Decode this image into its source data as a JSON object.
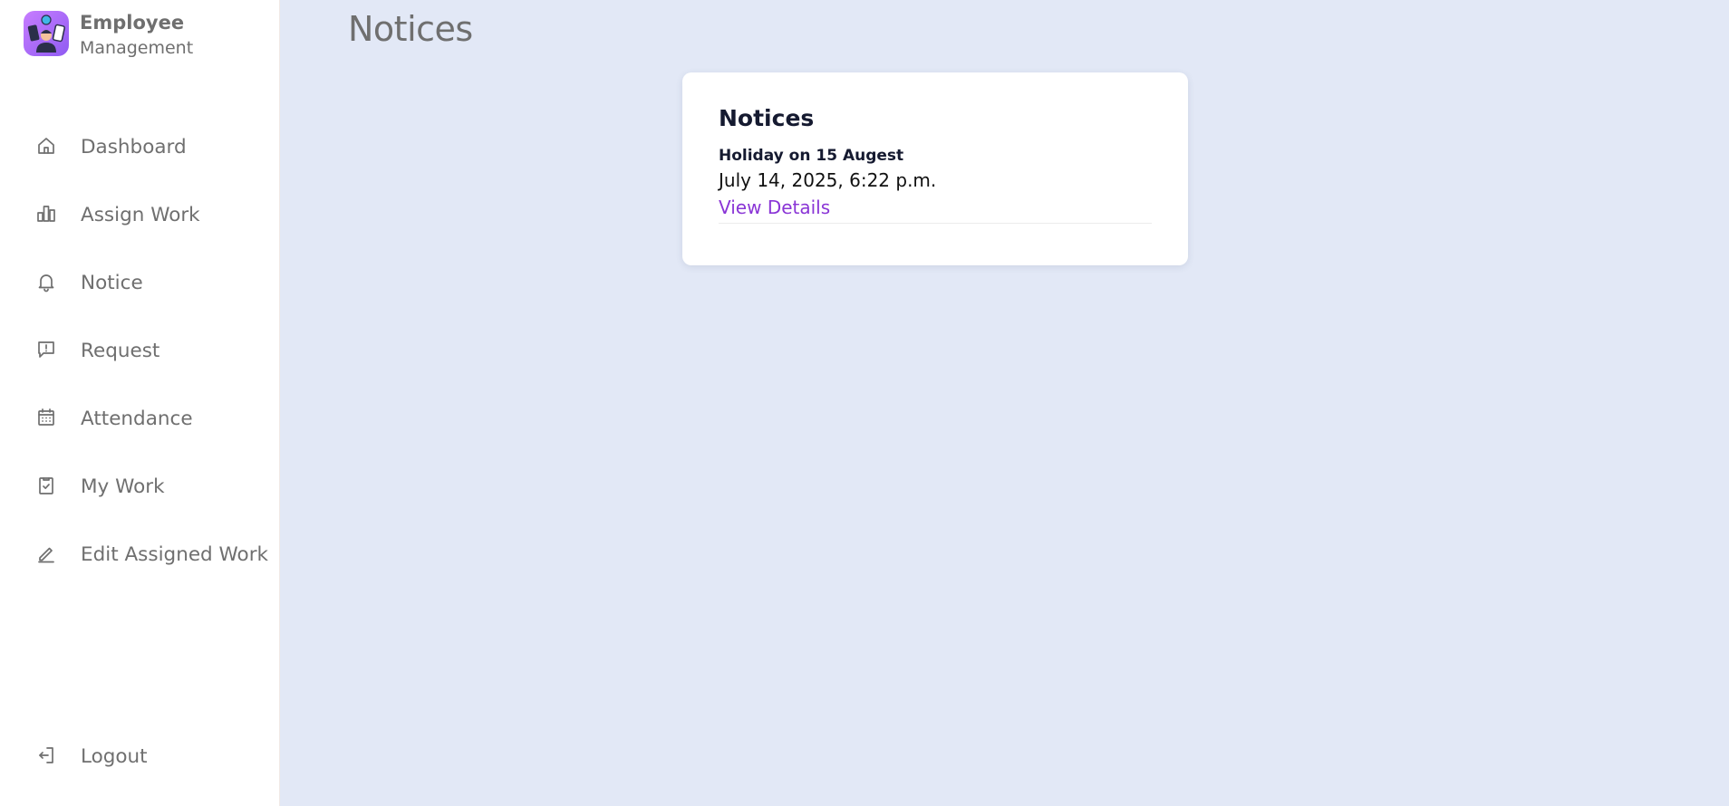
{
  "app": {
    "brand_line1": "Employee",
    "brand_line2": "Management"
  },
  "sidebar": {
    "items": [
      {
        "label": "Dashboard",
        "icon": "home-icon"
      },
      {
        "label": "Assign Work",
        "icon": "bar-chart-icon"
      },
      {
        "label": "Notice",
        "icon": "bell-icon"
      },
      {
        "label": "Request",
        "icon": "message-alert-icon"
      },
      {
        "label": "Attendance",
        "icon": "calendar-icon"
      },
      {
        "label": "My Work",
        "icon": "clipboard-check-icon"
      },
      {
        "label": "Edit Assigned Work",
        "icon": "pencil-icon"
      }
    ],
    "logout_label": "Logout"
  },
  "main": {
    "page_title": "Notices",
    "card": {
      "title": "Notices",
      "notices": [
        {
          "title": "Holiday on 15 Augest",
          "date": "July 14, 2025, 6:22 p.m.",
          "link_label": "View Details"
        }
      ]
    }
  },
  "colors": {
    "background": "#e2e8f6",
    "sidebar": "#ffffff",
    "nav_text": "#6f6f6f",
    "link": "#8a35d6",
    "logo_gradient_start": "#c77dff",
    "logo_gradient_end": "#8f5bf2"
  }
}
